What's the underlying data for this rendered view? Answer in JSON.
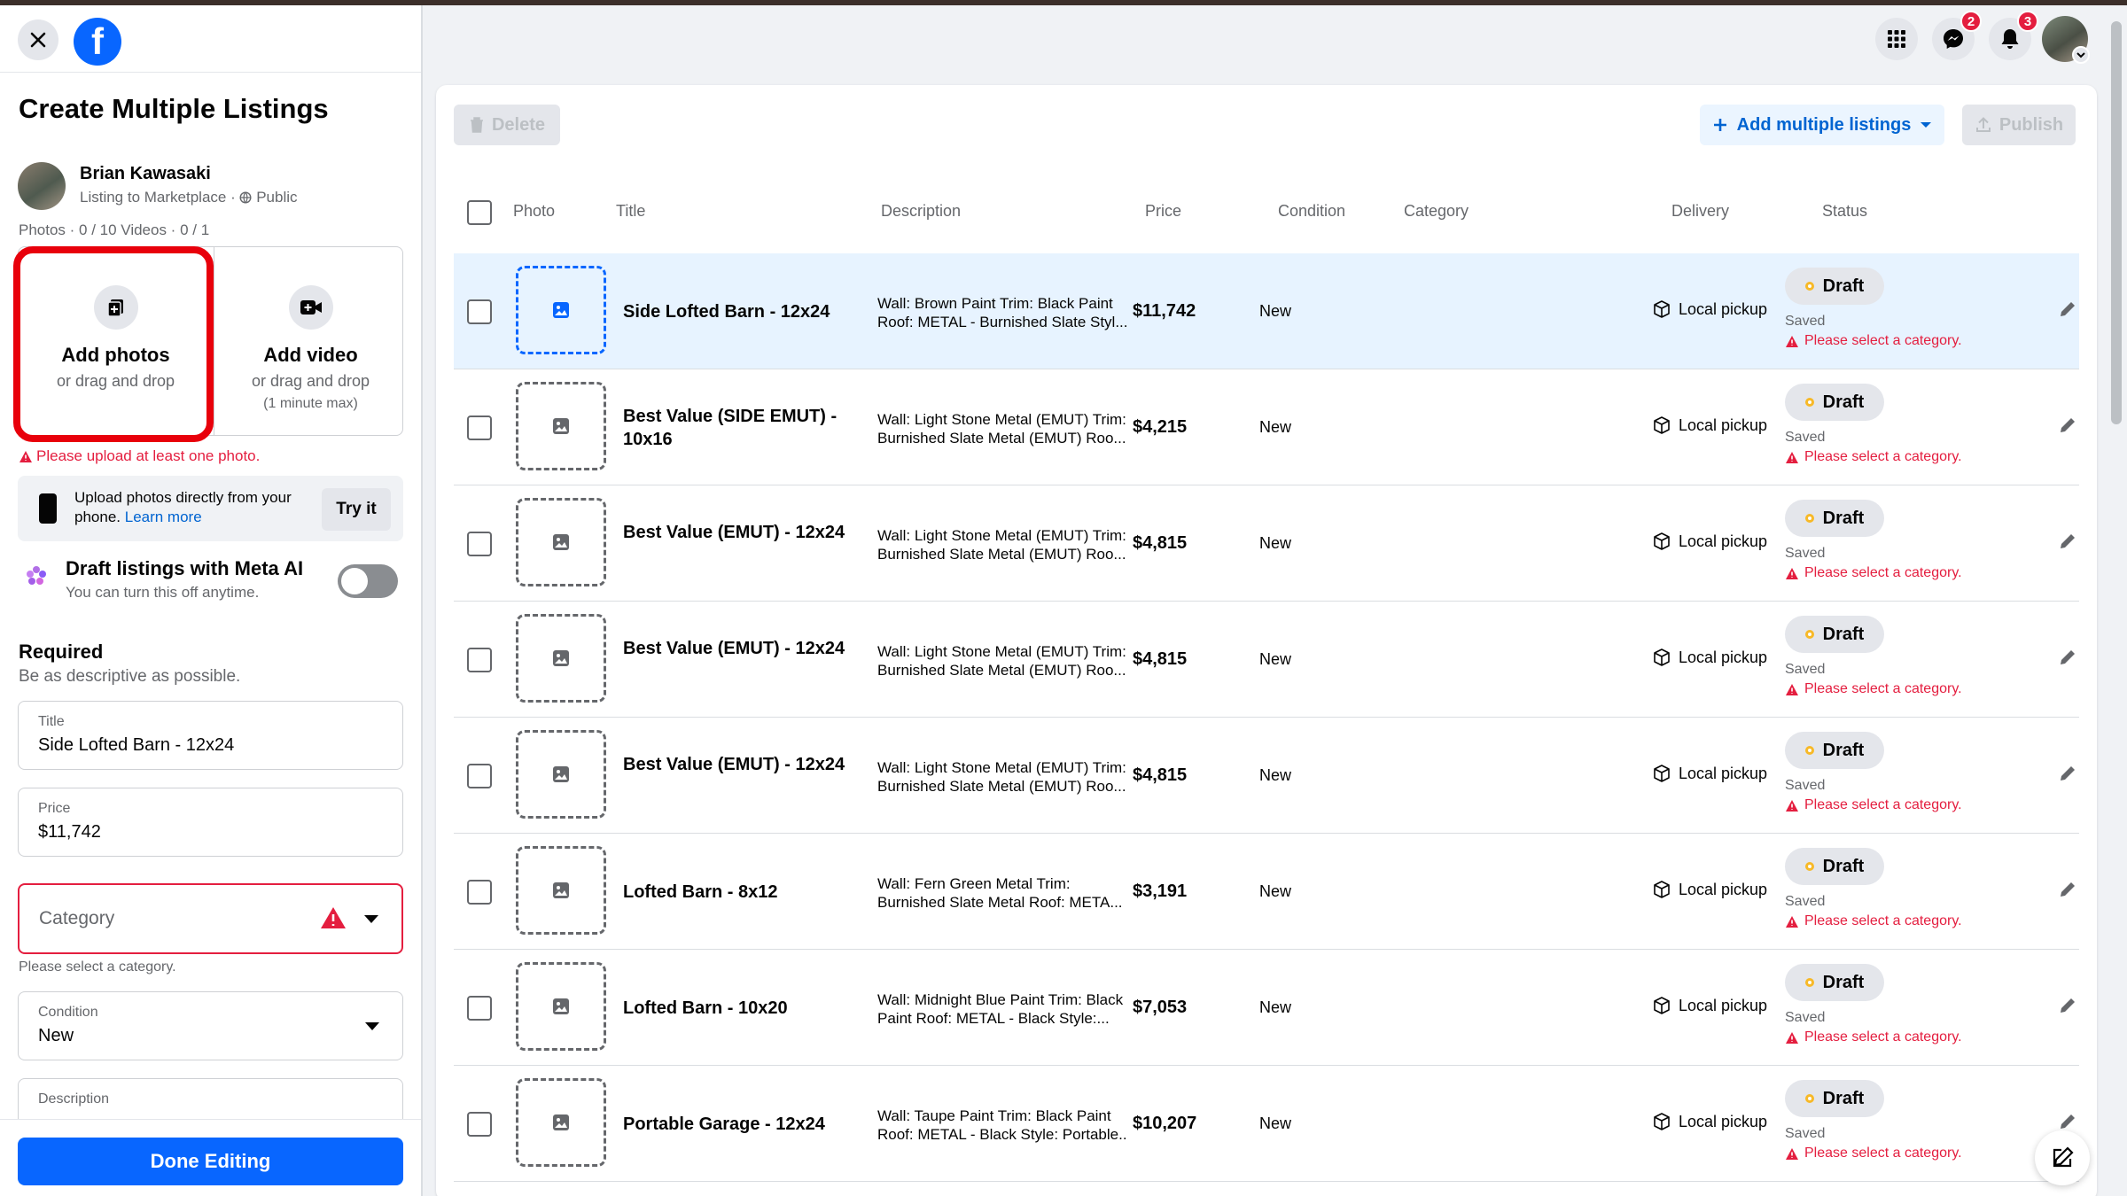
{
  "sidebar": {
    "title": "Create Multiple Listings",
    "user_name": "Brian Kawasaki",
    "user_sub": "Listing to Marketplace · ",
    "audience": "Public",
    "photo_counts": "Photos · 0 / 10 Videos · 0 / 1",
    "add_photos": "Add photos",
    "add_photos_sub": "or drag and drop",
    "add_video": "Add video",
    "add_video_sub": "or drag and drop",
    "add_video_note": "(1 minute max)",
    "photo_error": "Please upload at least one photo.",
    "upload_text": "Upload photos directly from your phone.",
    "learn_more": "Learn more",
    "try_it": "Try it",
    "ai_title": "Draft listings with Meta AI",
    "ai_sub": "You can turn this off anytime.",
    "ai_toggle_on": false,
    "required_title": "Required",
    "required_sub": "Be as descriptive as possible.",
    "title_label": "Title",
    "title_value": "Side Lofted Barn - 12x24",
    "price_label": "Price",
    "price_value": "$11,742",
    "category_placeholder": "Category",
    "category_help": "Please select a category.",
    "condition_label": "Condition",
    "condition_value": "New",
    "description_label": "Description",
    "done_button": "Done Editing"
  },
  "topbar": {
    "messenger_badge": "2",
    "notifications_badge": "3"
  },
  "toolbar": {
    "delete": "Delete",
    "add_multiple": "Add multiple listings",
    "publish": "Publish"
  },
  "table": {
    "headers": {
      "photo": "Photo",
      "title": "Title",
      "description": "Description",
      "price": "Price",
      "condition": "Condition",
      "category": "Category",
      "delivery": "Delivery",
      "status": "Status"
    },
    "rows": [
      {
        "title": "Side Lofted Barn - 12x24",
        "desc1": "Wall: Brown Paint Trim: Black Paint",
        "desc2": "Roof: METAL - Burnished Slate Styl...",
        "price": "$11,742",
        "condition": "New",
        "delivery": "Local pickup",
        "status": "Draft",
        "saved": "Saved",
        "error": "Please select a category."
      },
      {
        "title": "Best Value (SIDE EMUT) - 10x16",
        "desc1": "Wall: Light Stone Metal (EMUT) Trim:",
        "desc2": "Burnished Slate Metal (EMUT) Roo...",
        "price": "$4,215",
        "condition": "New",
        "delivery": "Local pickup",
        "status": "Draft",
        "saved": "Saved",
        "error": "Please select a category."
      },
      {
        "title": "Best Value (EMUT) - 12x24",
        "desc1": "Wall: Light Stone Metal (EMUT) Trim:",
        "desc2": "Burnished Slate Metal (EMUT) Roo...",
        "price": "$4,815",
        "condition": "New",
        "delivery": "Local pickup",
        "status": "Draft",
        "saved": "Saved",
        "error": "Please select a category."
      },
      {
        "title": "Best Value (EMUT) - 12x24",
        "desc1": "Wall: Light Stone Metal (EMUT) Trim:",
        "desc2": "Burnished Slate Metal (EMUT) Roo...",
        "price": "$4,815",
        "condition": "New",
        "delivery": "Local pickup",
        "status": "Draft",
        "saved": "Saved",
        "error": "Please select a category."
      },
      {
        "title": "Best Value (EMUT) - 12x24",
        "desc1": "Wall: Light Stone Metal (EMUT) Trim:",
        "desc2": "Burnished Slate Metal (EMUT) Roo...",
        "price": "$4,815",
        "condition": "New",
        "delivery": "Local pickup",
        "status": "Draft",
        "saved": "Saved",
        "error": "Please select a category."
      },
      {
        "title": "Lofted Barn - 8x12",
        "desc1": "Wall: Fern Green Metal Trim:",
        "desc2": "Burnished Slate Metal Roof: META...",
        "price": "$3,191",
        "condition": "New",
        "delivery": "Local pickup",
        "status": "Draft",
        "saved": "Saved",
        "error": "Please select a category."
      },
      {
        "title": "Lofted Barn - 10x20",
        "desc1": "Wall: Midnight Blue Paint Trim: Black",
        "desc2": "Paint Roof: METAL - Black Style:...",
        "price": "$7,053",
        "condition": "New",
        "delivery": "Local pickup",
        "status": "Draft",
        "saved": "Saved",
        "error": "Please select a category."
      },
      {
        "title": "Portable Garage - 12x24",
        "desc1": "Wall: Taupe Paint Trim: Black Paint",
        "desc2": "Roof: METAL - Black Style: Portable...",
        "price": "$10,207",
        "condition": "New",
        "delivery": "Local pickup",
        "status": "Draft",
        "saved": "Saved",
        "error": "Please select a category."
      }
    ]
  },
  "colors": {
    "brand": "#0866ff",
    "error": "#e41e3f",
    "selected_row": "#e7f3ff",
    "highlight": "#e8000b"
  },
  "icons": [
    "close-icon",
    "facebook-logo",
    "add-photo-icon",
    "add-video-icon",
    "phone-icon",
    "meta-ai-icon",
    "warning-icon",
    "chevron-down-icon",
    "apps-grid-icon",
    "messenger-icon",
    "bell-icon",
    "trash-icon",
    "plus-icon",
    "upload-icon",
    "image-icon",
    "package-icon",
    "pencil-icon",
    "compose-icon",
    "globe-icon"
  ]
}
